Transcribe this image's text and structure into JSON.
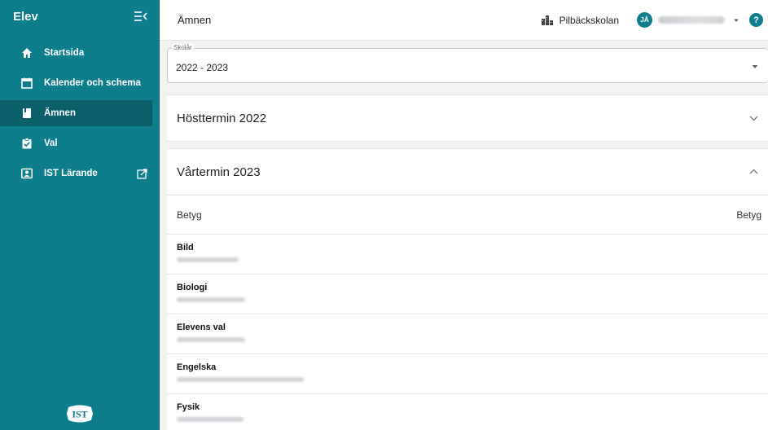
{
  "sidebar": {
    "title": "Elev",
    "items": [
      {
        "label": "Startsida",
        "icon": "home-icon",
        "active": false
      },
      {
        "label": "Kalender och schema",
        "icon": "calendar-icon",
        "active": false
      },
      {
        "label": "Ämnen",
        "icon": "book-icon",
        "active": true
      },
      {
        "label": "Val",
        "icon": "clipboard-check-icon",
        "active": false
      },
      {
        "label": "IST Lärande",
        "icon": "id-card-icon",
        "active": false,
        "external": true
      }
    ],
    "logo_text": "IST"
  },
  "topbar": {
    "page_title": "Ämnen",
    "school": "Pilbäckskolan",
    "avatar_initials": "JÅ",
    "help": "?"
  },
  "school_year": {
    "legend": "Skolår",
    "value": "2022 - 2023"
  },
  "terms": [
    {
      "title": "Hösttermin 2022",
      "expanded": false
    },
    {
      "title": "Vårtermin 2023",
      "expanded": true
    }
  ],
  "grades_table": {
    "left_header": "Betyg",
    "right_header": "Betyg",
    "subjects": [
      {
        "name": "Bild"
      },
      {
        "name": "Biologi"
      },
      {
        "name": "Elevens val"
      },
      {
        "name": "Engelska"
      },
      {
        "name": "Fysik"
      }
    ]
  },
  "colors": {
    "accent": "#0e7d8c",
    "accent_dark": "#0a5f6b",
    "background": "#f3f3f3"
  }
}
